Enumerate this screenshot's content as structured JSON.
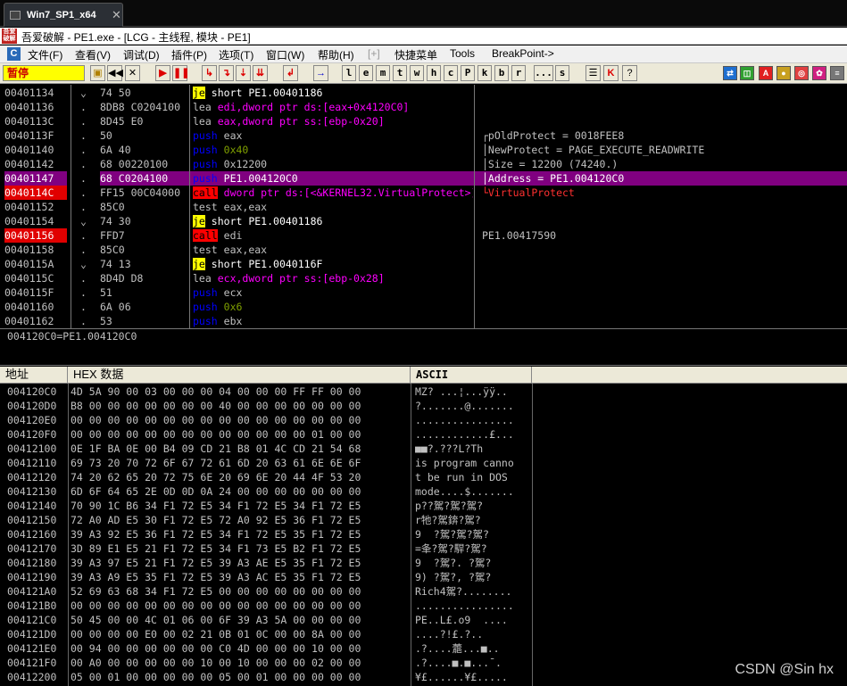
{
  "tab": {
    "label": "Win7_SP1_x64"
  },
  "title": {
    "app_badge": "吾爱破解",
    "text": "吾爱破解 - PE1.exe - [LCG - 主线程, 模块 - PE1]"
  },
  "menu": [
    "文件(F)",
    "查看(V)",
    "调试(D)",
    "插件(P)",
    "选项(T)",
    "窗口(W)",
    "帮助(H)",
    "[+]",
    "快捷菜单",
    "Tools",
    "BreakPoint->"
  ],
  "toolbar": {
    "pause": "暂停",
    "letters": [
      "l",
      "e",
      "m",
      "t",
      "w",
      "h",
      "c",
      "P",
      "k",
      "b",
      "r",
      "...",
      "s"
    ],
    "colors": [
      "#1e6fd0",
      "#30a030",
      "#e02020",
      "#c8a020",
      "#e04040",
      "#d02080",
      "#777777"
    ]
  },
  "cpu": {
    "rows": [
      {
        "addr": "00401134",
        "mark": "⌄",
        "bytes": "74 50",
        "op": "je",
        "args": "short PE1.00401186",
        "op_style": "je",
        "arg_style": "white",
        "comment": ""
      },
      {
        "addr": "00401136",
        "mark": ".",
        "bytes": "8DB8 C0204100",
        "op": "lea",
        "args": "edi,dword ptr ds:[eax+0x4120C0]",
        "op_style": "plain",
        "arg_style": "mem",
        "comment": ""
      },
      {
        "addr": "0040113C",
        "mark": ".",
        "bytes": "8D45 E0",
        "op": "lea",
        "args": "eax,dword ptr ss:[ebp-0x20]",
        "op_style": "plain",
        "arg_style": "mem",
        "comment": ""
      },
      {
        "addr": "0040113F",
        "mark": ".",
        "bytes": "50",
        "op": "push",
        "args": "eax",
        "op_style": "push",
        "arg_style": "def",
        "comment": "┌pOldProtect = 0018FEE8"
      },
      {
        "addr": "00401140",
        "mark": ".",
        "bytes": "6A 40",
        "op": "push",
        "args": "0x40",
        "op_style": "push",
        "arg_style": "imm",
        "comment": "│NewProtect = PAGE_EXECUTE_READWRITE"
      },
      {
        "addr": "00401142",
        "mark": ".",
        "bytes": "68 00220100",
        "op": "push",
        "args": "0x12200",
        "op_style": "push",
        "arg_style": "def",
        "comment": "│Size = 12200 (74240.)"
      },
      {
        "addr": "00401147",
        "mark": ".",
        "bytes": "68 C0204100",
        "op": "push",
        "args": "PE1.004120C0",
        "op_style": "push",
        "arg_style": "def",
        "comment": "│Address = PE1.004120C0",
        "selected": true
      },
      {
        "addr": "0040114C",
        "mark": ".",
        "bytes": "FF15 00C04000",
        "op": "call",
        "args": "dword ptr ds:[<&KERNEL32.VirtualProtect>]",
        "op_style": "call",
        "arg_style": "mem",
        "comment": "└VirtualProtect",
        "breakpoint": true
      },
      {
        "addr": "00401152",
        "mark": ".",
        "bytes": "85C0",
        "op": "test",
        "args": "eax,eax",
        "op_style": "plain",
        "arg_style": "def",
        "comment": ""
      },
      {
        "addr": "00401154",
        "mark": "⌄",
        "bytes": "74 30",
        "op": "je",
        "args": "short PE1.00401186",
        "op_style": "je",
        "arg_style": "white",
        "comment": ""
      },
      {
        "addr": "00401156",
        "mark": ".",
        "bytes": "FFD7",
        "op": "call",
        "args": "edi",
        "op_style": "call",
        "arg_style": "def",
        "comment": "PE1.00417590",
        "breakpoint": true
      },
      {
        "addr": "00401158",
        "mark": ".",
        "bytes": "85C0",
        "op": "test",
        "args": "eax,eax",
        "op_style": "plain",
        "arg_style": "def",
        "comment": ""
      },
      {
        "addr": "0040115A",
        "mark": "⌄",
        "bytes": "74 13",
        "op": "je",
        "args": "short PE1.0040116F",
        "op_style": "je",
        "arg_style": "white",
        "comment": ""
      },
      {
        "addr": "0040115C",
        "mark": ".",
        "bytes": "8D4D D8",
        "op": "lea",
        "args": "ecx,dword ptr ss:[ebp-0x28]",
        "op_style": "plain",
        "arg_style": "mem",
        "comment": ""
      },
      {
        "addr": "0040115F",
        "mark": ".",
        "bytes": "51",
        "op": "push",
        "args": "ecx",
        "op_style": "push",
        "arg_style": "def",
        "comment": ""
      },
      {
        "addr": "00401160",
        "mark": ".",
        "bytes": "6A 06",
        "op": "push",
        "args": "0x6",
        "op_style": "push",
        "arg_style": "imm",
        "comment": ""
      },
      {
        "addr": "00401162",
        "mark": ".",
        "bytes": "53",
        "op": "push",
        "args": "ebx",
        "op_style": "push",
        "arg_style": "def",
        "comment": ""
      }
    ]
  },
  "info": {
    "text": "004120C0=PE1.004120C0"
  },
  "dump": {
    "headers": {
      "address": "地址",
      "hex": "HEX 数据",
      "ascii": "ASCII"
    },
    "rows": [
      {
        "addr": "004120C0",
        "hex": "4D 5A 90 00 03 00 00 00 04 00 00 00 FF FF 00 00",
        "ascii": "MZ? ...¦...ÿÿ.."
      },
      {
        "addr": "004120D0",
        "hex": "B8 00 00 00 00 00 00 00 40 00 00 00 00 00 00 00",
        "ascii": "?.......@......."
      },
      {
        "addr": "004120E0",
        "hex": "00 00 00 00 00 00 00 00 00 00 00 00 00 00 00 00",
        "ascii": "................"
      },
      {
        "addr": "004120F0",
        "hex": "00 00 00 00 00 00 00 00 00 00 00 00 00 01 00 00",
        "ascii": "............£..."
      },
      {
        "addr": "00412100",
        "hex": "0E 1F BA 0E 00 B4 09 CD 21 B8 01 4C CD 21 54 68",
        "ascii": "■■?.???L?Th"
      },
      {
        "addr": "00412110",
        "hex": "69 73 20 70 72 6F 67 72 61 6D 20 63 61 6E 6E 6F",
        "ascii": "is program canno"
      },
      {
        "addr": "00412120",
        "hex": "74 20 62 65 20 72 75 6E 20 69 6E 20 44 4F 53 20",
        "ascii": "t be run in DOS "
      },
      {
        "addr": "00412130",
        "hex": "6D 6F 64 65 2E 0D 0D 0A 24 00 00 00 00 00 00 00",
        "ascii": "mode....$......."
      },
      {
        "addr": "00412140",
        "hex": "70 90 1C B6 34 F1 72 E5 34 F1 72 E5 34 F1 72 E5",
        "ascii": "p??駕?駕?駕?"
      },
      {
        "addr": "00412150",
        "hex": "72 A0 AD E5 30 F1 72 E5 72 A0 92 E5 36 F1 72 E5",
        "ascii": "r牠?駕錛?駕?"
      },
      {
        "addr": "00412160",
        "hex": "39 A3 92 E5 36 F1 72 E5 34 F1 72 E5 35 F1 72 E5",
        "ascii": "9  ?駕?駕?駕?"
      },
      {
        "addr": "00412170",
        "hex": "3D 89 E1 E5 21 F1 72 E5 34 F1 73 E5 B2 F1 72 E5",
        "ascii": "=夆?駕?駻?駕?"
      },
      {
        "addr": "00412180",
        "hex": "39 A3 97 E5 21 F1 72 E5 39 A3 AE E5 35 F1 72 E5",
        "ascii": "9  ?駕?. ?駕?"
      },
      {
        "addr": "00412190",
        "hex": "39 A3 A9 E5 35 F1 72 E5 39 A3 AC E5 35 F1 72 E5",
        "ascii": "9) ?駕?, ?駕?"
      },
      {
        "addr": "004121A0",
        "hex": "52 69 63 68 34 F1 72 E5 00 00 00 00 00 00 00 00",
        "ascii": "Rich4駕?........"
      },
      {
        "addr": "004121B0",
        "hex": "00 00 00 00 00 00 00 00 00 00 00 00 00 00 00 00",
        "ascii": "................"
      },
      {
        "addr": "004121C0",
        "hex": "50 45 00 00 4C 01 06 00 6F 39 A3 5A 00 00 00 00",
        "ascii": "PE..L£.o9  ...."
      },
      {
        "addr": "004121D0",
        "hex": "00 00 00 00 E0 00 02 21 0B 01 0C 00 00 8A 00 00",
        "ascii": "....?!£.?.."
      },
      {
        "addr": "004121E0",
        "hex": "00 94 00 00 00 00 00 00 C0 4D 00 00 00 10 00 00",
        "ascii": ".?....蘎...■.."
      },
      {
        "addr": "004121F0",
        "hex": "00 A0 00 00 00 00 00 10 00 10 00 00 00 02 00 00",
        "ascii": ".?....■.■...¯."
      },
      {
        "addr": "00412200",
        "hex": "05 00 01 00 00 00 00 00 05 00 01 00 00 00 00 00",
        "ascii": "¥£......¥£....."
      }
    ]
  },
  "watermark": "CSDN @Sin hx"
}
